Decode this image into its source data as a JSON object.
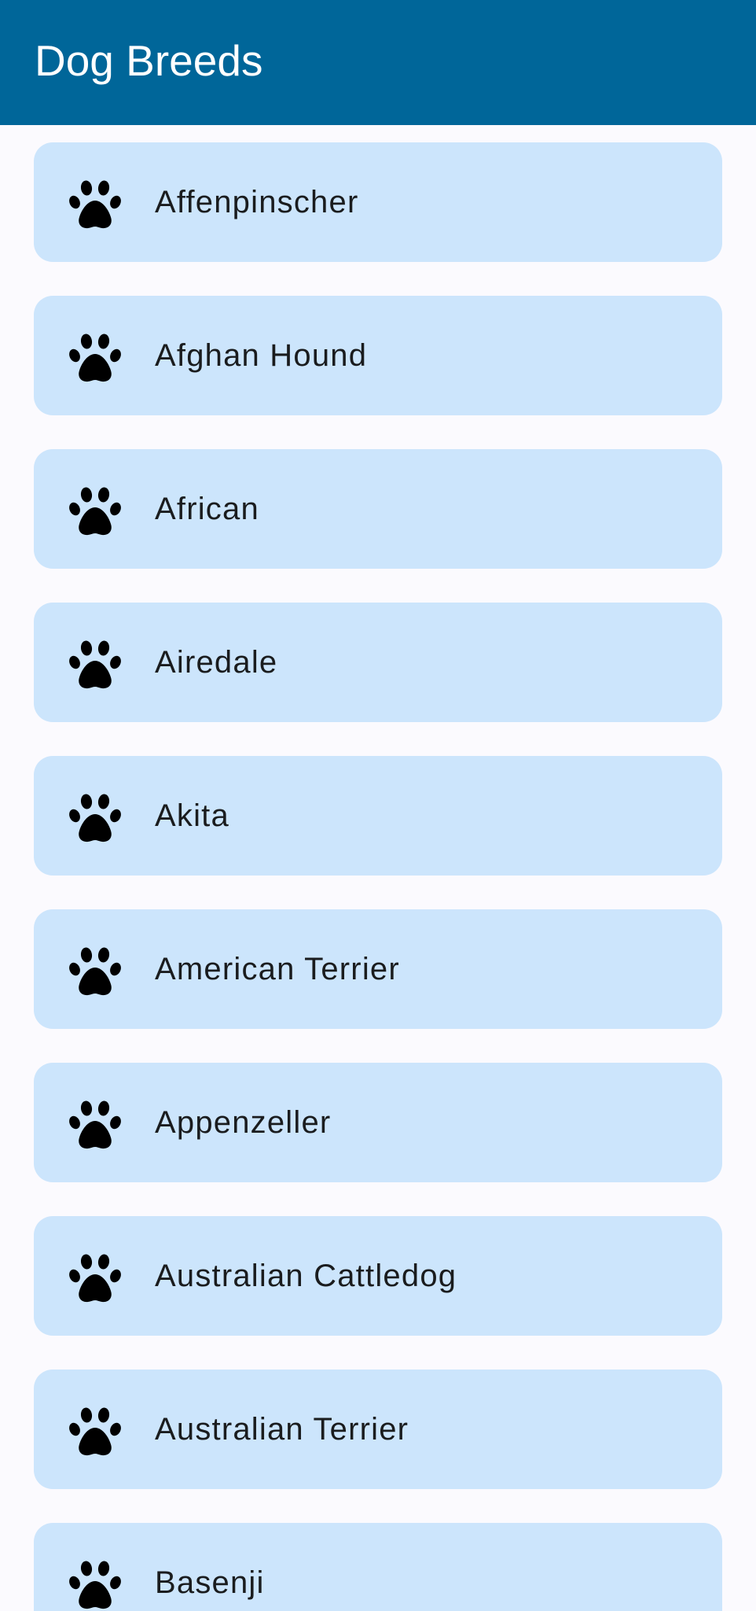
{
  "app_bar": {
    "title": "Dog Breeds",
    "background": "#006699",
    "title_color": "#FFFFFF"
  },
  "list": {
    "card_background": "#CCE5FC",
    "icon": "paw-icon",
    "items": [
      {
        "label": "Affenpinscher"
      },
      {
        "label": "Afghan Hound"
      },
      {
        "label": "African"
      },
      {
        "label": "Airedale"
      },
      {
        "label": "Akita"
      },
      {
        "label": "American Terrier"
      },
      {
        "label": "Appenzeller"
      },
      {
        "label": "Australian Cattledog"
      },
      {
        "label": "Australian Terrier"
      },
      {
        "label": "Basenji"
      }
    ]
  }
}
